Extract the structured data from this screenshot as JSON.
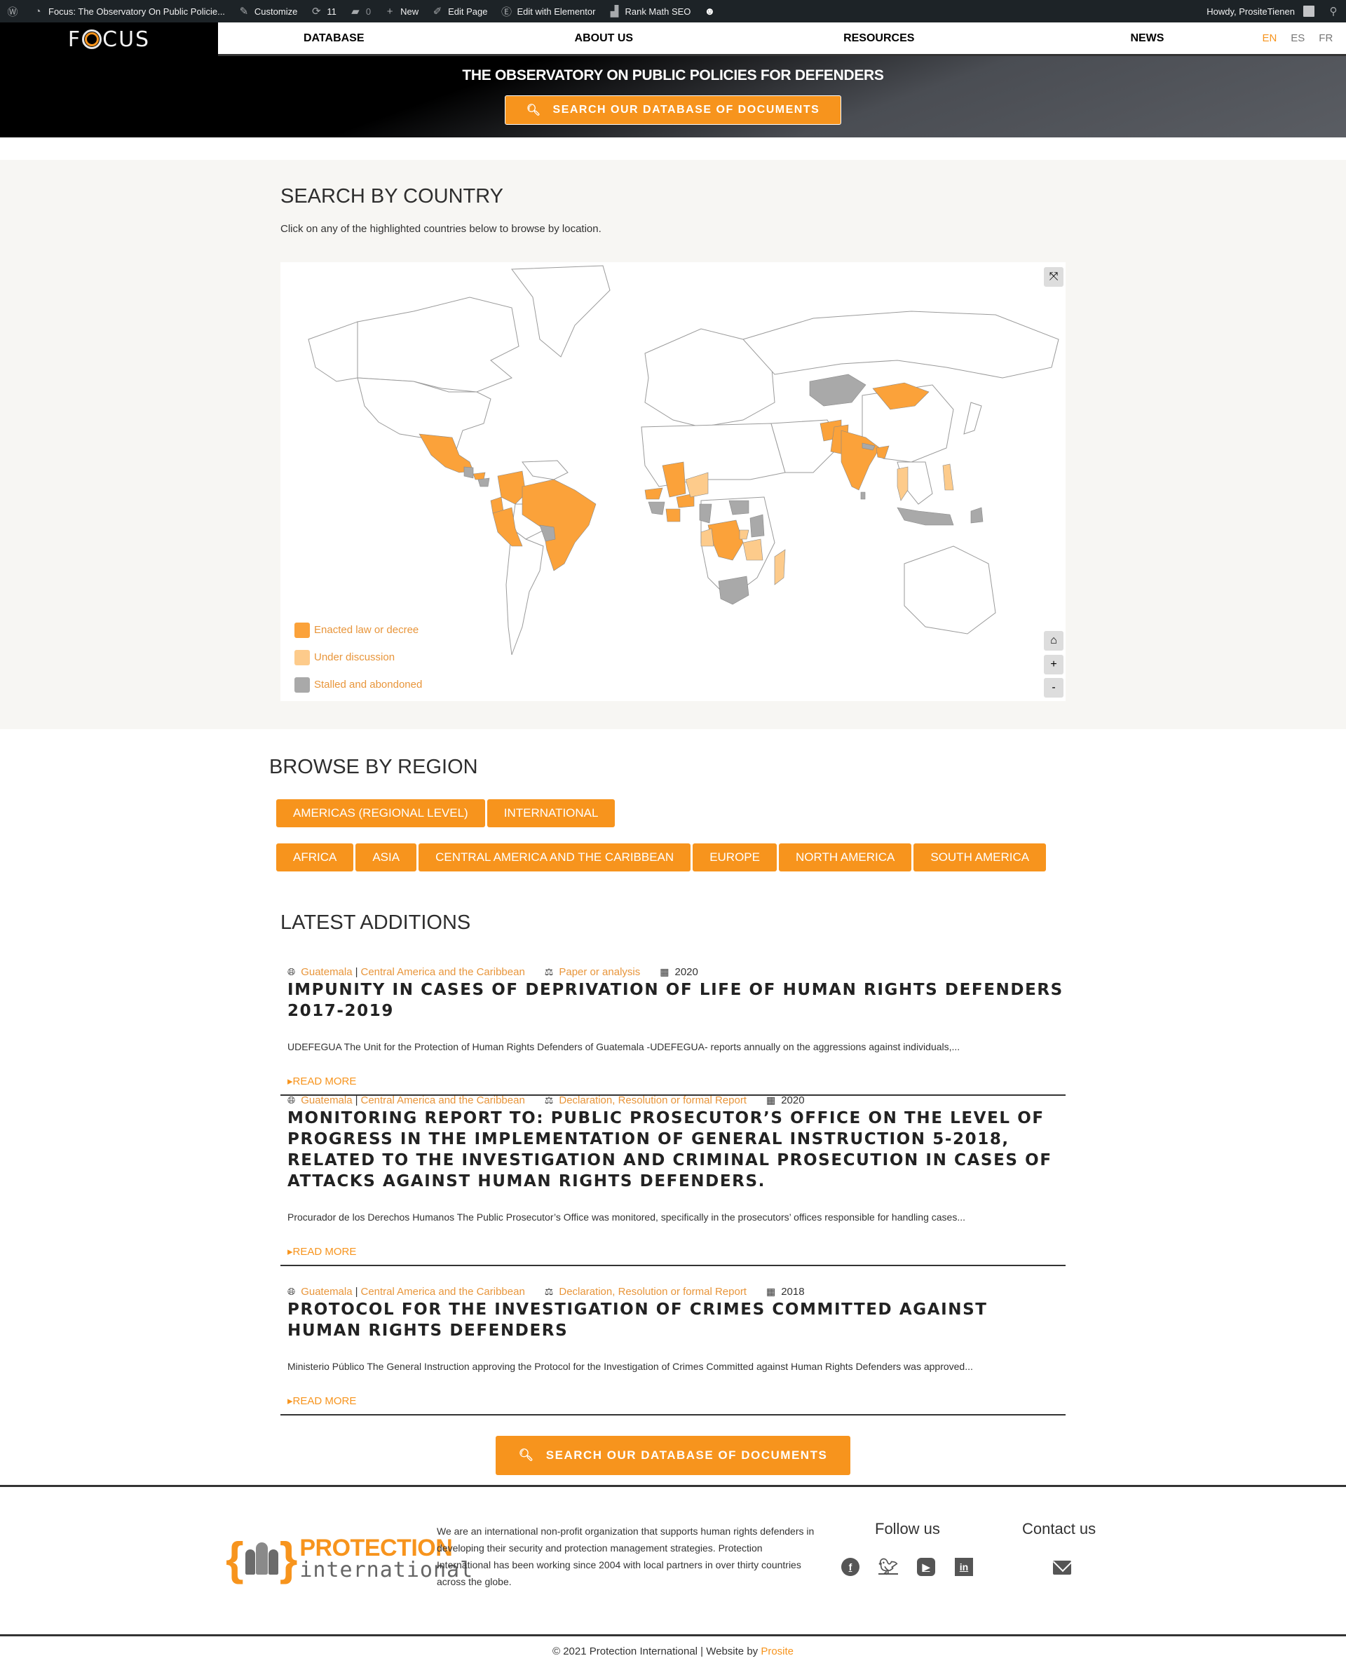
{
  "admin_bar": {
    "site_title": "Focus: The Observatory On Public Policie...",
    "customize": "Customize",
    "updates_count": "11",
    "comments_count": "0",
    "new": "New",
    "edit_page": "Edit Page",
    "edit_elementor": "Edit with Elementor",
    "rank_math": "Rank Math SEO",
    "howdy": "Howdy, PrositeTienen"
  },
  "header": {
    "logo_text_left": "F",
    "logo_text_right": "CUS",
    "nav": [
      {
        "label": "DATABASE"
      },
      {
        "label": "ABOUT US"
      },
      {
        "label": "RESOURCES"
      },
      {
        "label": "NEWS"
      }
    ],
    "languages": [
      {
        "code": "EN",
        "active": true
      },
      {
        "code": "ES",
        "active": false
      },
      {
        "code": "FR",
        "active": false
      }
    ]
  },
  "hero": {
    "title": "THE OBSERVATORY ON PUBLIC POLICIES FOR DEFENDERS",
    "cta_label": "SEARCH OUR DATABASE OF DOCUMENTS"
  },
  "search_by_country": {
    "title": "SEARCH BY COUNTRY",
    "hint": "Click on any of the highlighted countries below to browse by location.",
    "controls": {
      "fullscreen": "fullscreen-icon",
      "home": "home-icon",
      "zoom_in": "+",
      "zoom_out": "-"
    },
    "legend": [
      {
        "label": "Enacted law or decree",
        "color": "#fba23a"
      },
      {
        "label": "Under discussion",
        "color": "#fdcb8b"
      },
      {
        "label": "Stalled and abondoned",
        "color": "#a9a9a9"
      }
    ],
    "countries": {
      "enacted": [
        "Mexico",
        "Honduras",
        "Colombia",
        "Ecuador",
        "Peru",
        "Brazil",
        "Mali",
        "Senegal",
        "Burkina Faso",
        "Côte d'Ivoire",
        "DR Congo",
        "Mongolia",
        "Afghanistan",
        "Pakistan",
        "India",
        "Bangladesh"
      ],
      "under_discussion": [
        "Niger",
        "Congo",
        "Rwanda",
        "Tanzania",
        "Madagascar",
        "Thailand",
        "Philippines"
      ],
      "stalled": [
        "Guatemala",
        "Nicaragua",
        "Paraguay",
        "Guinea",
        "Sierra Leone",
        "Togo",
        "Cameroon",
        "South Sudan",
        "Kenya",
        "South Africa",
        "Kazakhstan",
        "Nepal",
        "Sri Lanka",
        "Indonesia",
        "Papua New Guinea"
      ]
    }
  },
  "browse_by_region": {
    "title": "BROWSE BY REGION",
    "row1": [
      {
        "label": "AMERICAS (REGIONAL LEVEL)"
      },
      {
        "label": "INTERNATIONAL"
      }
    ],
    "row2": [
      {
        "label": "AFRICA"
      },
      {
        "label": "ASIA"
      },
      {
        "label": "CENTRAL AMERICA AND THE CARIBBEAN"
      },
      {
        "label": "EUROPE"
      },
      {
        "label": "NORTH AMERICA"
      },
      {
        "label": "SOUTH AMERICA"
      }
    ]
  },
  "latest_additions": {
    "title": "LATEST ADDITIONS",
    "read_more": "READ MORE",
    "items": [
      {
        "country": "Guatemala",
        "region": "Central America and the Caribbean",
        "type": "Paper or analysis",
        "year": "2020",
        "title": "IMPUNITY IN CASES OF DEPRIVATION OF LIFE OF HUMAN RIGHTS DEFENDERS 2017-2019",
        "excerpt": "UDEFEGUA  The Unit for the Protection of Human Rights Defenders of Guatemala -UDEFEGUA- reports annually on the aggressions against individuals,..."
      },
      {
        "country": "Guatemala",
        "region": "Central America and the Caribbean",
        "type": "Declaration, Resolution or formal Report",
        "year": "2020",
        "title": "MONITORING REPORT TO: PUBLIC PROSECUTOR’S OFFICE ON THE LEVEL OF PROGRESS IN THE IMPLEMENTATION OF GENERAL INSTRUCTION 5-2018, RELATED TO THE INVESTIGATION AND CRIMINAL PROSECUTION IN CASES OF ATTACKS AGAINST HUMAN RIGHTS DEFENDERS.",
        "excerpt": "Procurador de los Derechos Humanos The Public Prosecutor’s Office was monitored, specifically in the prosecutors’ offices responsible for handling cases..."
      },
      {
        "country": "Guatemala",
        "region": "Central America and the Caribbean",
        "type": "Declaration, Resolution or formal Report",
        "year": "2018",
        "title": "PROTOCOL FOR THE INVESTIGATION OF CRIMES COMMITTED AGAINST HUMAN RIGHTS DEFENDERS",
        "excerpt": "Ministerio Público The General Instruction approving the Protocol for the Investigation of Crimes Committed against Human Rights Defenders was approved..."
      }
    ],
    "cta_label": "SEARCH OUR DATABASE OF DOCUMENTS"
  },
  "footer": {
    "logo_word1": "PROTECTION",
    "logo_word2": "international",
    "about": "We are an international non-profit organization that supports human rights defenders in developing their security and protection management strategies. Protection International has been working since 2004 with local partners in over thirty countries across the globe.",
    "follow_title": "Follow us",
    "contact_title": "Contact us",
    "social": [
      "facebook-icon",
      "twitter-icon",
      "youtube-icon",
      "linkedin-icon"
    ],
    "copyright": "© 2021 Protection International | Website by ",
    "credit": "Prosite"
  },
  "colors": {
    "accent": "#f7941d",
    "enacted": "#fba23a",
    "under_discussion": "#fdcb8b",
    "stalled": "#a9a9a9",
    "dark": "#1d2327"
  }
}
